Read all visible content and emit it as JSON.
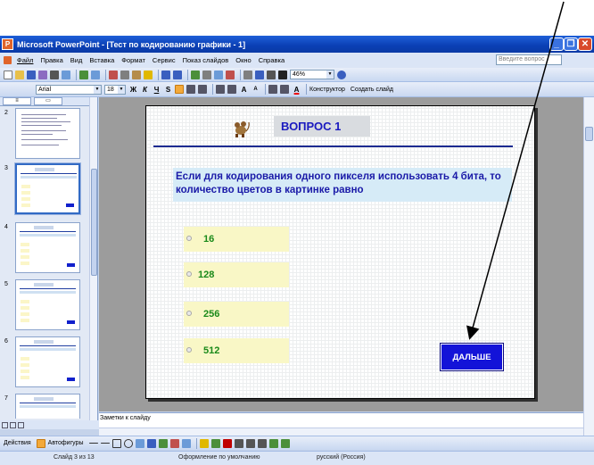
{
  "window": {
    "title": "Microsoft PowerPoint - [Тест по кодированию графики - 1]",
    "app_icon": "P"
  },
  "menu": {
    "items": [
      "Файл",
      "Правка",
      "Вид",
      "Вставка",
      "Формат",
      "Сервис",
      "Показ слайдов",
      "Окно",
      "Справка"
    ],
    "help_placeholder": "Введите вопрос"
  },
  "toolbar": {
    "zoom": "46%",
    "font_name": "Arial",
    "font_size": "18",
    "bold": "Ж",
    "italic": "К",
    "underline": "Ч",
    "shadow": "S",
    "grow_font": "A",
    "shrink_font": "A",
    "font_color": "A",
    "designer_label": "Конструктор",
    "new_slide_label": "Создать слайд"
  },
  "panel": {
    "tab_outline": "",
    "tab_slides": "",
    "slide_numbers": [
      "2",
      "3",
      "4",
      "5",
      "6",
      "7"
    ]
  },
  "slide": {
    "title": "ВОПРОС 1",
    "question": "Если для кодирования одного пикселя использовать 4 бита, то количество цветов в картинке равно",
    "answers": [
      "16",
      "128",
      "256",
      "512"
    ],
    "next_button": "ДАЛЬШЕ"
  },
  "notes": {
    "placeholder": "Заметки к слайду"
  },
  "draw_toolbar": {
    "actions": "Действия",
    "autoshapes": "Автофигуры"
  },
  "status": {
    "slide": "Слайд 3 из 13",
    "design": "Оформление по умолчанию",
    "language": "русский (Россия)"
  },
  "colors": {
    "slide_title_bg": "#d9dce0",
    "answer_bg": "#f9f7c6",
    "answer_text": "#1a8a1a",
    "next_bg": "#1313d8",
    "question_bg": "#d6ebf7"
  }
}
